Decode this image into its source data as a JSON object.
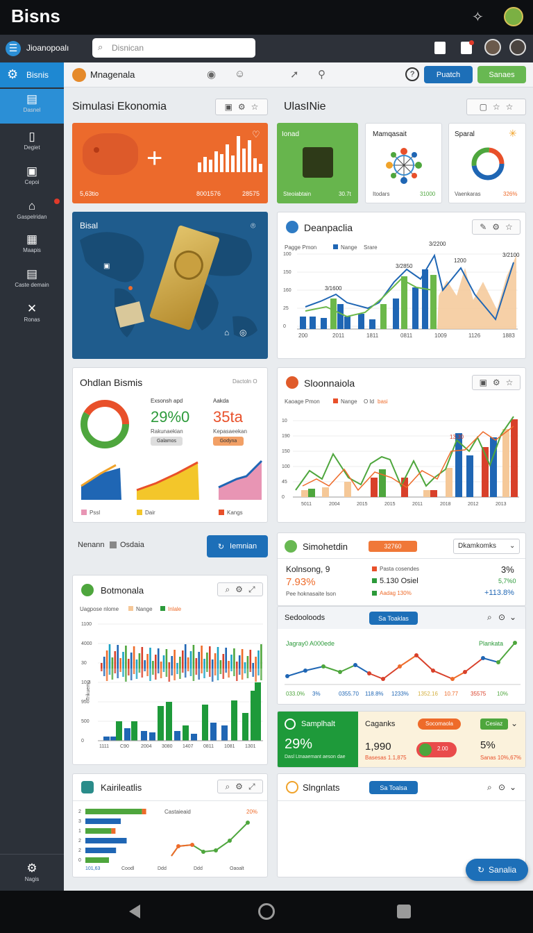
{
  "status_bar": {
    "app_name": "Bisns",
    "pin_icon": "pin-icon"
  },
  "app_bar": {
    "menu_label": "Jioanopoalı",
    "search_placeholder": "Disnican"
  },
  "sidebar": {
    "items": [
      {
        "label": "Dasnel",
        "icon": "document-icon"
      },
      {
        "label": "Degiet",
        "icon": "page-icon"
      },
      {
        "label": "Cepoi",
        "icon": "camera-icon"
      },
      {
        "label": "Gaspelridan",
        "icon": "home-icon"
      },
      {
        "label": "Maapis",
        "icon": "grid-icon"
      },
      {
        "label": "Caste demain",
        "icon": "calendar-icon"
      },
      {
        "label": "Ronas",
        "icon": "tools-icon"
      }
    ],
    "brand": "Bisnis",
    "settings_label": "Nagis"
  },
  "subbar": {
    "user": "Mnagenala",
    "btn_blue": "Puatch",
    "btn_green": "Sanaes"
  },
  "left_section_title": "Simulasi Ekonomia",
  "right_section_title": "UlasINie",
  "tile_orange": {
    "left": "5,63tio",
    "mid": "8001576",
    "right": "28575"
  },
  "tile_green": {
    "title": "Ionad",
    "left": "Steoiabtain",
    "right": "30.7t"
  },
  "tile_network": {
    "title": "Mamqasait",
    "left": "Itodars",
    "right": "31000"
  },
  "tile_donut": {
    "title": "Sparal",
    "left": "Vaenkaras",
    "right": "326%"
  },
  "map_card": {
    "title": "Bisal"
  },
  "chart1": {
    "title": "Deanpaclia",
    "legend": [
      "Pagge Pmon",
      "Nange",
      "Srare"
    ],
    "yticks": [
      "100",
      "150",
      "160",
      "25",
      "0"
    ],
    "xticks": [
      "200",
      "2011",
      "1811",
      "0811",
      "1009",
      "1126",
      "1883"
    ],
    "annotations": [
      "3/1600",
      "3/2850",
      "3/2200",
      "1200",
      "3/2100"
    ]
  },
  "card_ohdlan": {
    "title": "Ohdlan Bismis",
    "corner": "Dactoln O",
    "stat1_label": "Exsonsh apd",
    "stat1_value": "29%0",
    "stat1_sub": "Rakunaekian",
    "stat1_btn": "Galamos",
    "stat2_label": "Aakda",
    "stat2_value": "35ta",
    "stat2_sub": "Kepasaeekan",
    "stat2_btn": "Godyna",
    "mini_legends": [
      "Pssl",
      "Dair",
      "Kangs"
    ]
  },
  "chart2": {
    "title": "Sloonnaiola",
    "legend": [
      "Kaoage Pmon",
      "Nange",
      "O Id",
      "basi"
    ],
    "yticks": [
      "10",
      "190",
      "150",
      "100",
      "45",
      "0"
    ],
    "xticks": [
      "5011",
      "2004",
      "2015",
      "2015",
      "2011",
      "2018",
      "2012",
      "2013"
    ],
    "annotations": [
      "13.30"
    ]
  },
  "toolbar_left": {
    "label1": "Nenann",
    "label2": "Osdaia",
    "button": "Iemnian"
  },
  "card_simohetdin": {
    "title": "Simohetdin",
    "badge": "32760",
    "select": "Dkamkomks",
    "metric_title": "Kolnsong, 9",
    "metric_value": "7.93%",
    "metric_sub": "Pee hoknasaite lson",
    "list": [
      "Pasta cosendes",
      "5.130 Osiel",
      "Aadag 130%"
    ],
    "right_values": [
      "3%",
      "5,7%0",
      "+113.8%"
    ]
  },
  "card_sedooloods": {
    "title": "Sedooloods",
    "button": "Sa Toaklas",
    "line_title": "Jagray0 A000ede",
    "line_right": "Plankata",
    "xvalues": [
      "033.0%",
      "3%",
      "0355.70",
      "118.8%",
      "1233%",
      "1352.16",
      "10.77",
      "35575",
      "10%"
    ]
  },
  "card_botmonala": {
    "title": "Botmonala",
    "legend": [
      "Uagpose nlome",
      "Nange",
      "Inlale"
    ],
    "yticks": [
      "1100",
      "4000",
      "30",
      "10.3",
      "950",
      "500",
      "0"
    ],
    "xticks": [
      "1111",
      "C90",
      "2004",
      "3080",
      "1407",
      "0811",
      "1081",
      "1301"
    ],
    "yaxis_label": "Trikuemo"
  },
  "card_samplht": {
    "title": "Samplhalt",
    "value": "29%",
    "sub": "Dasl Ltnaaemant aeson dae",
    "right_title": "Caganks",
    "right_badge": "Socomaola",
    "right_badge2": "Cesiaz",
    "val1": "1,990",
    "val1_sub": "Basesas 1.1,875",
    "val2": "5%",
    "val2_sub": "Sanas 10%,67%",
    "chip": "2.00"
  },
  "card_kairileatlis": {
    "title": "Kairileatlis",
    "chart_title": "Castaieaid",
    "pct": "20%",
    "yticks": [
      "2",
      "3",
      "1",
      "2",
      "2",
      "0"
    ],
    "xticks": [
      "101,63",
      "Coodl",
      "Ddd",
      "Ddd",
      "Oaoalt"
    ]
  },
  "card_slngnlats": {
    "title": "Slngnlats",
    "button": "Sa Toalsa"
  },
  "fab": {
    "label": "Sanalia"
  },
  "colors": {
    "blue": "#1f66b4",
    "green": "#4ea63d",
    "orange": "#ee6b2a",
    "red": "#d8402a",
    "peach": "#f5c898",
    "dark": "#2c3139"
  }
}
